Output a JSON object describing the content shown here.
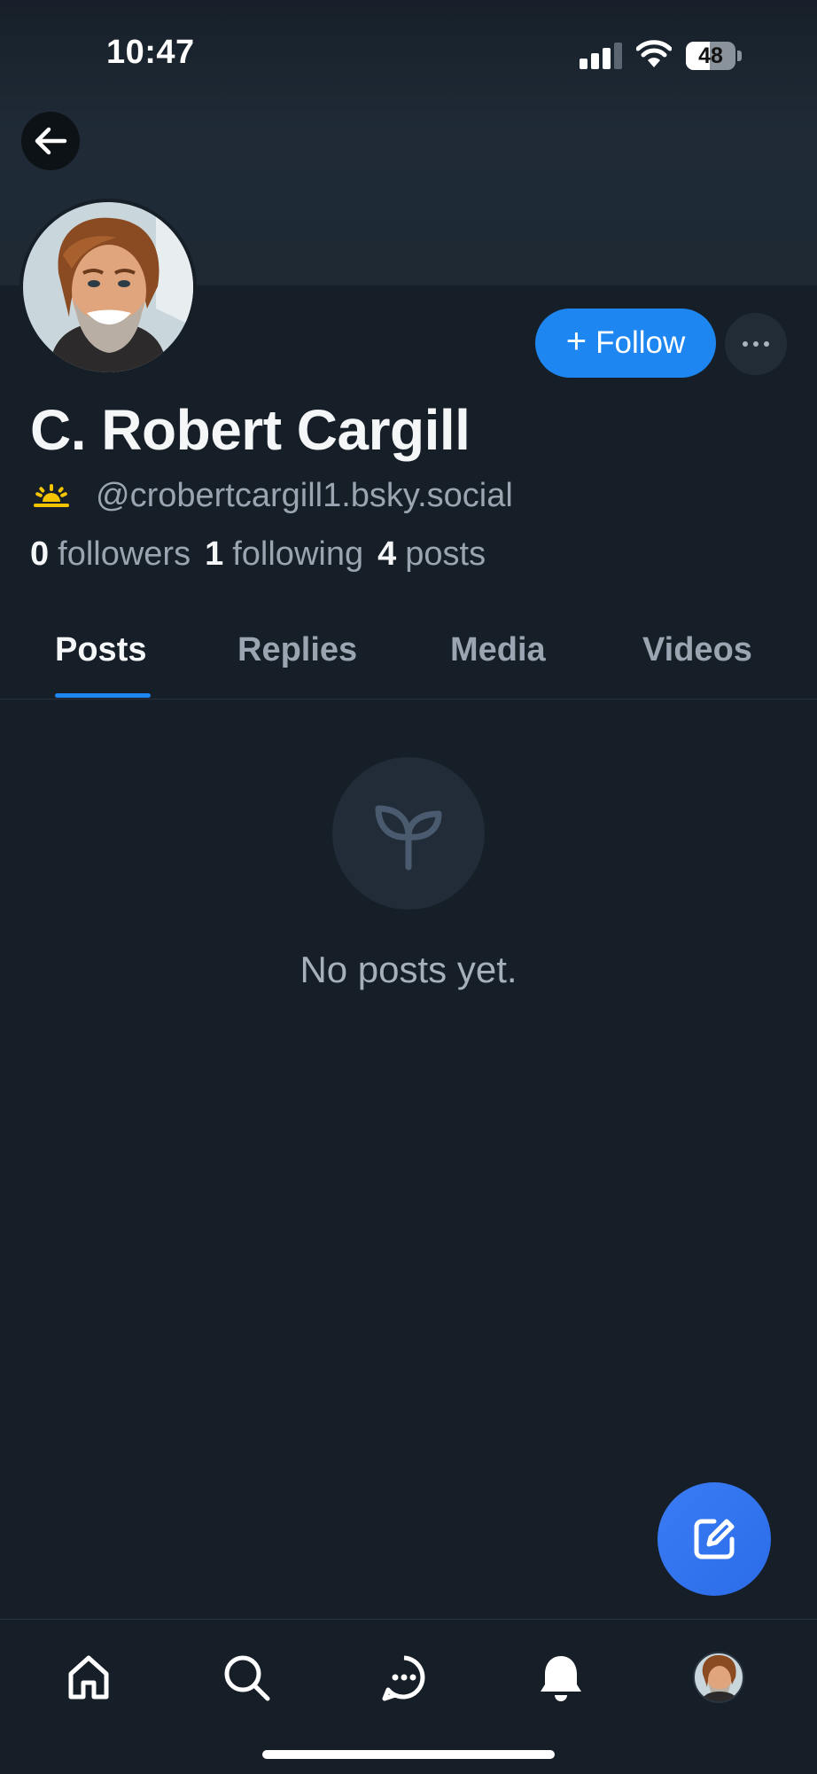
{
  "status_bar": {
    "time": "10:47",
    "battery": "48",
    "battery_level": 0.48
  },
  "profile": {
    "display_name": "C. Robert Cargill",
    "handle": "@crobertcargill1.bsky.social",
    "stats": {
      "followers_count": "0",
      "followers_label": "followers",
      "following_count": "1",
      "following_label": "following",
      "posts_count": "4",
      "posts_label": "posts"
    }
  },
  "actions": {
    "follow_icon": "+",
    "follow_label": "Follow"
  },
  "tabs": [
    {
      "label": "Posts",
      "active": true
    },
    {
      "label": "Replies",
      "active": false
    },
    {
      "label": "Media",
      "active": false
    },
    {
      "label": "Videos",
      "active": false
    }
  ],
  "empty_state": {
    "icon": "seedling-icon",
    "text": "No posts yet."
  },
  "bottom_nav": {
    "items": [
      "home-icon",
      "search-icon",
      "chat-icon",
      "bell-icon",
      "avatar"
    ]
  },
  "colors": {
    "accent": "#1e86f0",
    "background": "#161e27",
    "sun_icon": "#f5c400"
  }
}
